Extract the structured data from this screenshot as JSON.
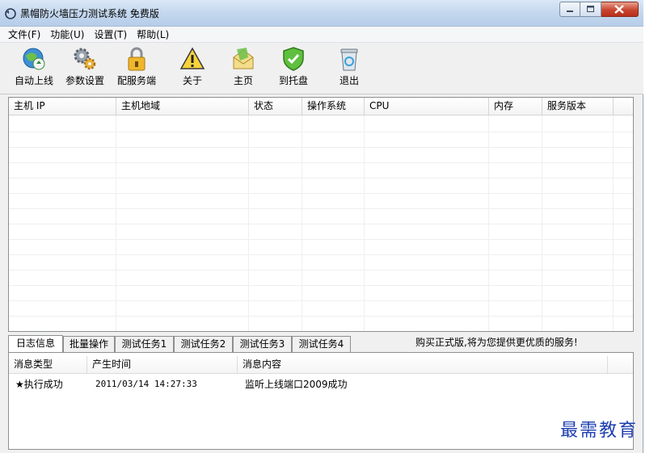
{
  "window": {
    "title": "黑帽防火墙压力测试系统 免费版"
  },
  "menu": {
    "items": [
      "文件(F)",
      "功能(U)",
      "设置(T)",
      "帮助(L)"
    ]
  },
  "toolbar": {
    "items": [
      {
        "label": "自动上线",
        "icon": "globe-recycle-icon"
      },
      {
        "label": "参数设置",
        "icon": "gears-icon"
      },
      {
        "label": "配服务端",
        "icon": "padlock-icon"
      },
      {
        "label": "关于",
        "icon": "warning-icon"
      },
      {
        "label": "主页",
        "icon": "envelope-icon"
      },
      {
        "label": "到托盘",
        "icon": "shield-icon"
      },
      {
        "label": "退出",
        "icon": "recycle-bin-icon"
      }
    ]
  },
  "host_table": {
    "columns": [
      "主机 IP",
      "主机地域",
      "状态",
      "操作系统",
      "CPU",
      "内存",
      "服务版本"
    ]
  },
  "tabs": {
    "items": [
      "日志信息",
      "批量操作",
      "测试任务1",
      "测试任务2",
      "测试任务3",
      "测试任务4"
    ],
    "active": "日志信息"
  },
  "promo_text": "购买正式版,将为您提供更优质的服务!",
  "log_table": {
    "columns": [
      "消息类型",
      "产生时间",
      "消息内容"
    ],
    "rows": [
      {
        "type": "★执行成功",
        "time": "2011/03/14 14:27:33",
        "content": "监听上线端口2009成功"
      }
    ]
  },
  "watermark": "最需教育"
}
